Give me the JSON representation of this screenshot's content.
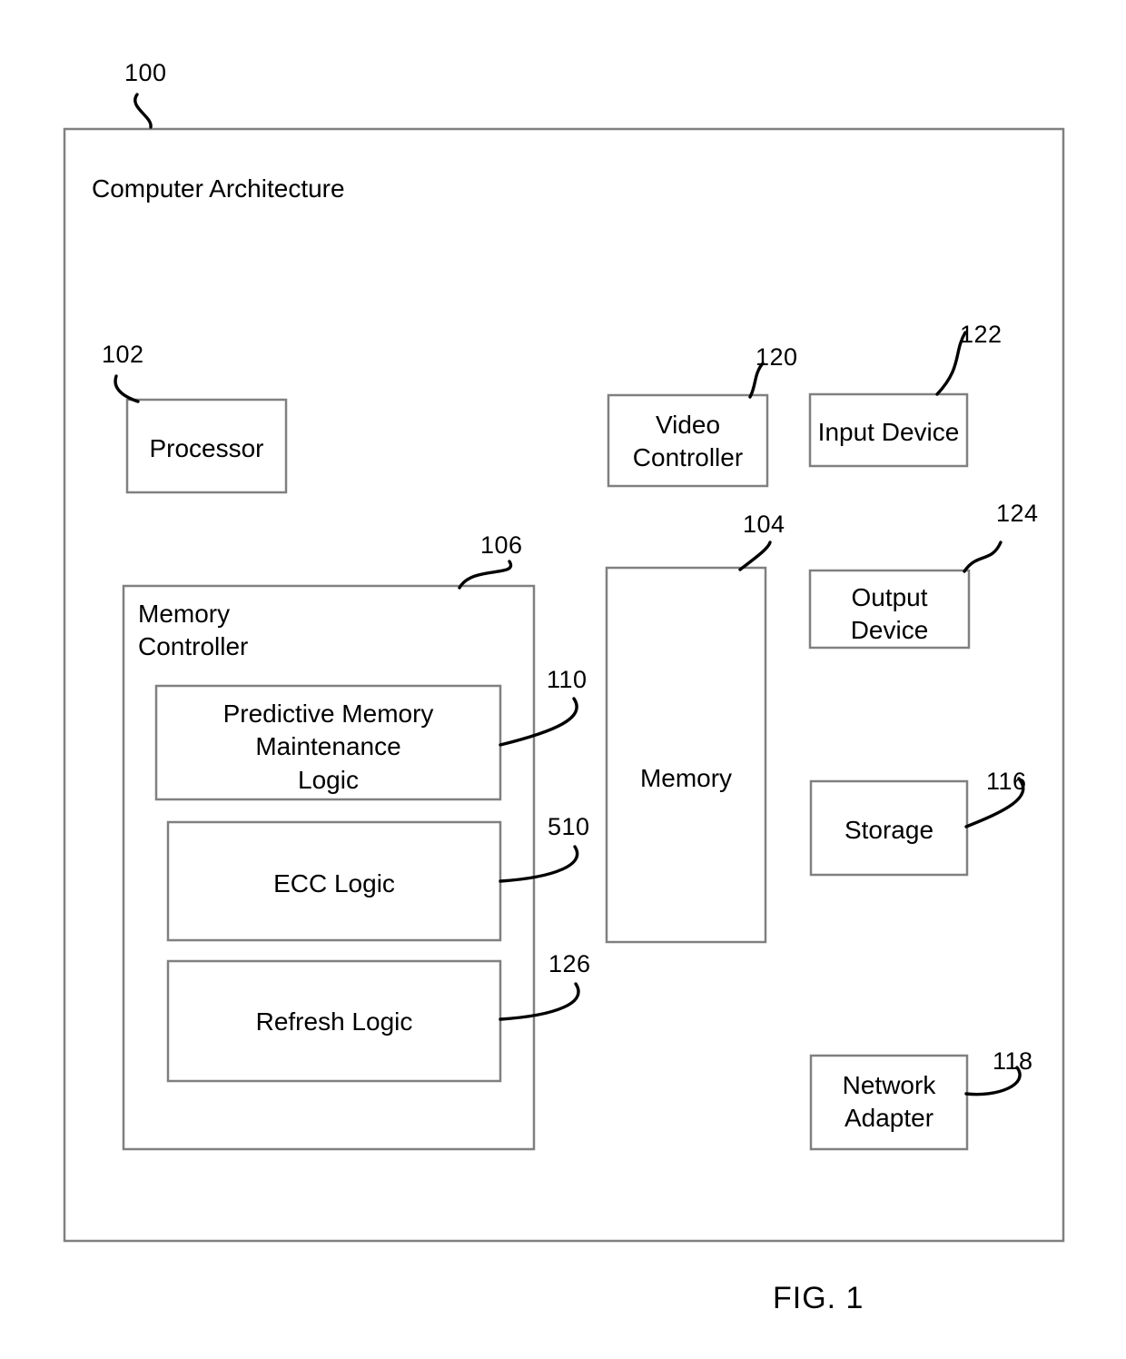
{
  "figure": {
    "caption": "FIG. 1",
    "outer": {
      "title": "Computer Architecture",
      "ref": "100"
    }
  },
  "blocks": [
    {
      "id": "processor",
      "label": "Processor",
      "ref": "102"
    },
    {
      "id": "video_controller",
      "label": "Video\nController",
      "ref": "120"
    },
    {
      "id": "input_device",
      "label": "Input Device",
      "ref": "122"
    },
    {
      "id": "memory_controller",
      "label": "Memory\nController",
      "ref": "106"
    },
    {
      "id": "pmm_logic",
      "label": "Predictive Memory\nMaintenance\nLogic",
      "ref": "110"
    },
    {
      "id": "ecc_logic",
      "label": "ECC Logic",
      "ref": "510"
    },
    {
      "id": "refresh_logic",
      "label": "Refresh Logic",
      "ref": "126"
    },
    {
      "id": "memory",
      "label": "Memory",
      "ref": "104"
    },
    {
      "id": "output_device",
      "label": "Output\nDevice",
      "ref": "124"
    },
    {
      "id": "storage",
      "label": "Storage",
      "ref": "116"
    },
    {
      "id": "network_adapter",
      "label": "Network\nAdapter",
      "ref": "118"
    }
  ],
  "colors": {
    "stroke": "#808080",
    "leader": "#000000",
    "text": "#000000",
    "background": "#ffffff"
  }
}
